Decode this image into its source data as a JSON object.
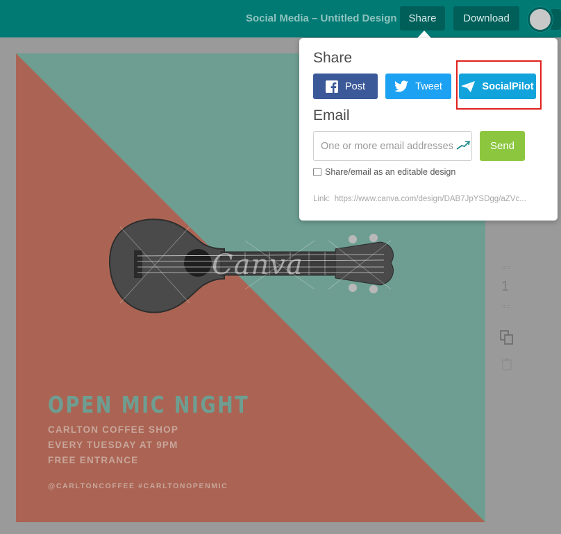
{
  "header": {
    "title": "Social Media – Untitled Design",
    "share_label": "Share",
    "download_label": "Download"
  },
  "design": {
    "watermark": "Canva",
    "headline": "OPEN MIC NIGHT",
    "line1": "CARLTON COFFEE SHOP",
    "line2": "EVERY TUESDAY AT 9PM",
    "line3": "FREE ENTRANCE",
    "tags": "@CARLTONCOFFEE #CARLTONOPENMIC",
    "colors": {
      "teal": "#6e9e92",
      "terracotta": "#ab6453"
    }
  },
  "rail": {
    "page_number": "1"
  },
  "share_popover": {
    "heading": "Share",
    "buttons": [
      {
        "label": "Post",
        "icon": "facebook-icon",
        "color": "#3b5998"
      },
      {
        "label": "Tweet",
        "icon": "twitter-icon",
        "color": "#1da1f2"
      },
      {
        "label": "SocialPilot",
        "icon": "paper-plane-icon",
        "color": "#13a3dc",
        "highlighted": true
      }
    ],
    "email_heading": "Email",
    "email_placeholder": "One or more email addresses",
    "send_label": "Send",
    "editable_checkbox_label": "Share/email as an editable design",
    "editable_checked": false,
    "link_label": "Link:",
    "link_value": "https://www.canva.com/design/DAB7JpYSDgg/aZVc..."
  }
}
